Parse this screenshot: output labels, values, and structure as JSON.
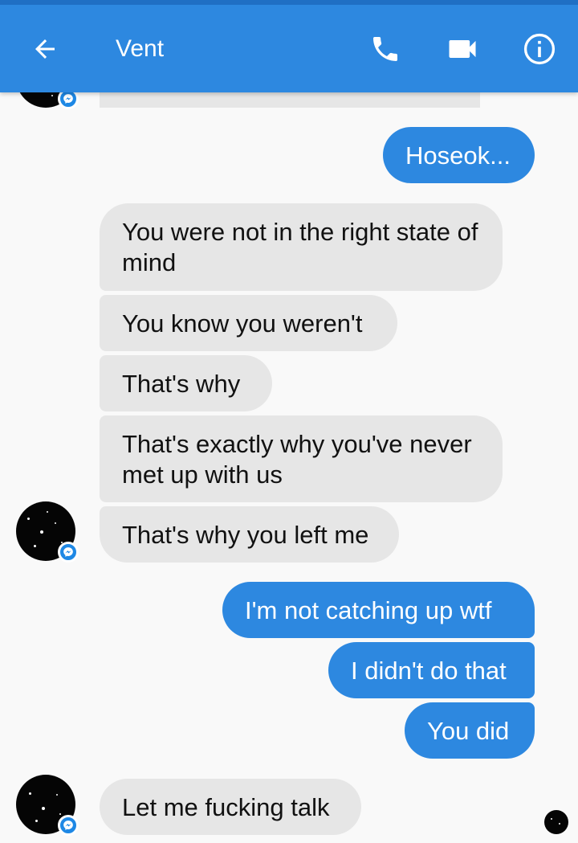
{
  "header": {
    "title": "Vent",
    "icons": [
      "back-arrow-icon",
      "phone-icon",
      "video-camera-icon",
      "info-icon"
    ]
  },
  "colors": {
    "header_bg": "#2d88e0",
    "outgoing_bubble": "#2d88e0",
    "incoming_bubble": "#e6e6e6",
    "background": "#f9f9f9"
  },
  "messages": [
    {
      "direction": "out",
      "text": "Hoseok..."
    },
    {
      "direction": "in",
      "text": "You were not in the right state of mind"
    },
    {
      "direction": "in",
      "text": "You know you weren't"
    },
    {
      "direction": "in",
      "text": "That's why"
    },
    {
      "direction": "in",
      "text": "That's exactly why you've never met up with us"
    },
    {
      "direction": "in",
      "text": "That's why you left me"
    },
    {
      "direction": "out",
      "text": "I'm not catching up wtf"
    },
    {
      "direction": "out",
      "text": "I didn't do that"
    },
    {
      "direction": "out",
      "text": "You did"
    },
    {
      "direction": "in",
      "text": "Let me fucking talk"
    }
  ]
}
